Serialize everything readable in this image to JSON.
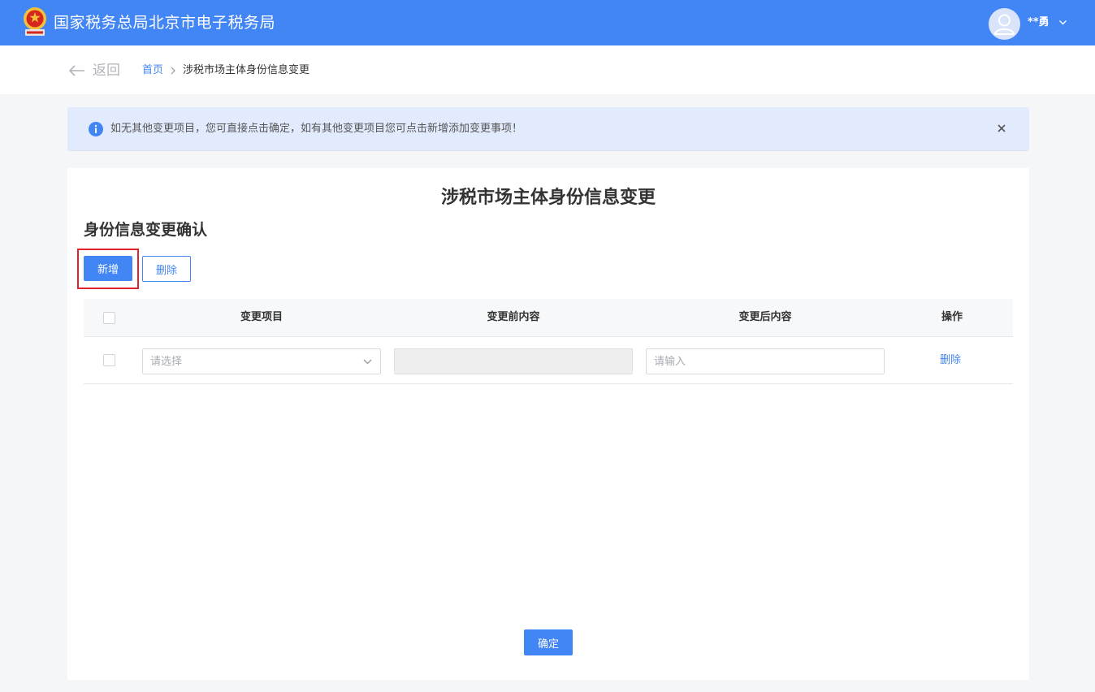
{
  "header": {
    "site_title": "国家税务总局北京市电子税务局",
    "user_name": "**勇",
    "logo_icon": "tax-emblem-icon",
    "avatar_icon": "user-avatar-icon"
  },
  "breadcrumb": {
    "back_label": "返回",
    "home": "首页",
    "current": "涉税市场主体身份信息变更"
  },
  "notice": {
    "text": "如无其他变更项目，您可直接点击确定，如有其他变更项目您可点击新增添加变更事项！"
  },
  "main": {
    "page_title": "涉税市场主体身份信息变更",
    "section_title": "身份信息变更确认",
    "add_button": "新增",
    "delete_button": "删除",
    "confirm_button": "确定"
  },
  "table": {
    "headers": {
      "item": "变更项目",
      "before": "变更前内容",
      "after": "变更后内容",
      "action": "操作"
    },
    "rows": [
      {
        "item_placeholder": "请选择",
        "before_value": "",
        "after_placeholder": "请输入",
        "action_label": "删除"
      }
    ]
  },
  "colors": {
    "primary": "#4285f4",
    "highlight": "#e0232b",
    "notice_bg": "#e2ebfd"
  }
}
